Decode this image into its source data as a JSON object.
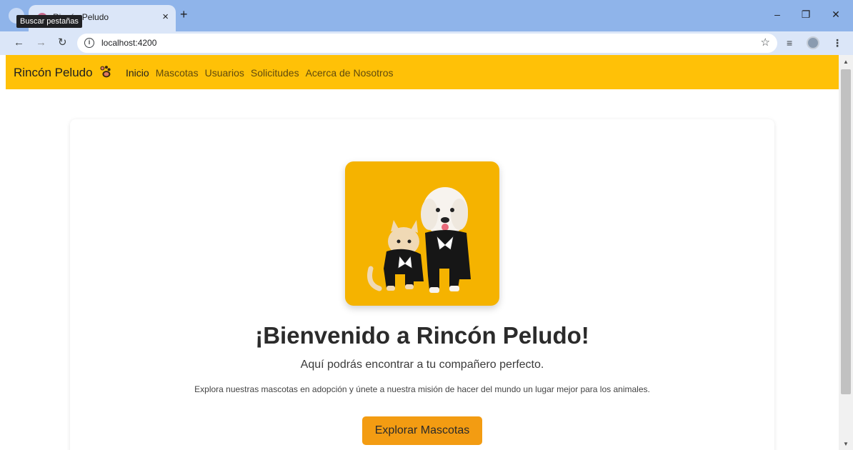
{
  "browser": {
    "tab_title": "Rincón Peludo",
    "tooltip": "Buscar pestañas",
    "tab_close": "×",
    "new_tab": "+",
    "url": "localhost:4200",
    "window_controls": {
      "minimize": "–",
      "restore": "❐",
      "close": "✕"
    },
    "icons": {
      "back": "arrow-left-icon",
      "forward": "arrow-right-icon",
      "reload": "reload-icon",
      "info": "info-icon",
      "bookmark": "star-icon",
      "reading_list": "reading-list-icon",
      "profile": "avatar",
      "menu": "kebab-menu-icon"
    }
  },
  "navbar": {
    "brand": "Rincón Peludo",
    "links": [
      "Inicio",
      "Mascotas",
      "Usuarios",
      "Solicitudes",
      "Acerca de Nosotros"
    ],
    "active_link": "Inicio",
    "background": "#ffc107"
  },
  "hero": {
    "image": "dog-and-cat-photo",
    "title": "¡Bienvenido a Rincón Peludo!",
    "subtitle": "Aquí podrás encontrar a tu compañero perfecto.",
    "description": "Explora nuestras mascotas en adopción y únete a nuestra misión de hacer del mundo un lugar mejor para los animales.",
    "cta_label": "Explorar Mascotas",
    "cta_color": "#f39c12"
  }
}
